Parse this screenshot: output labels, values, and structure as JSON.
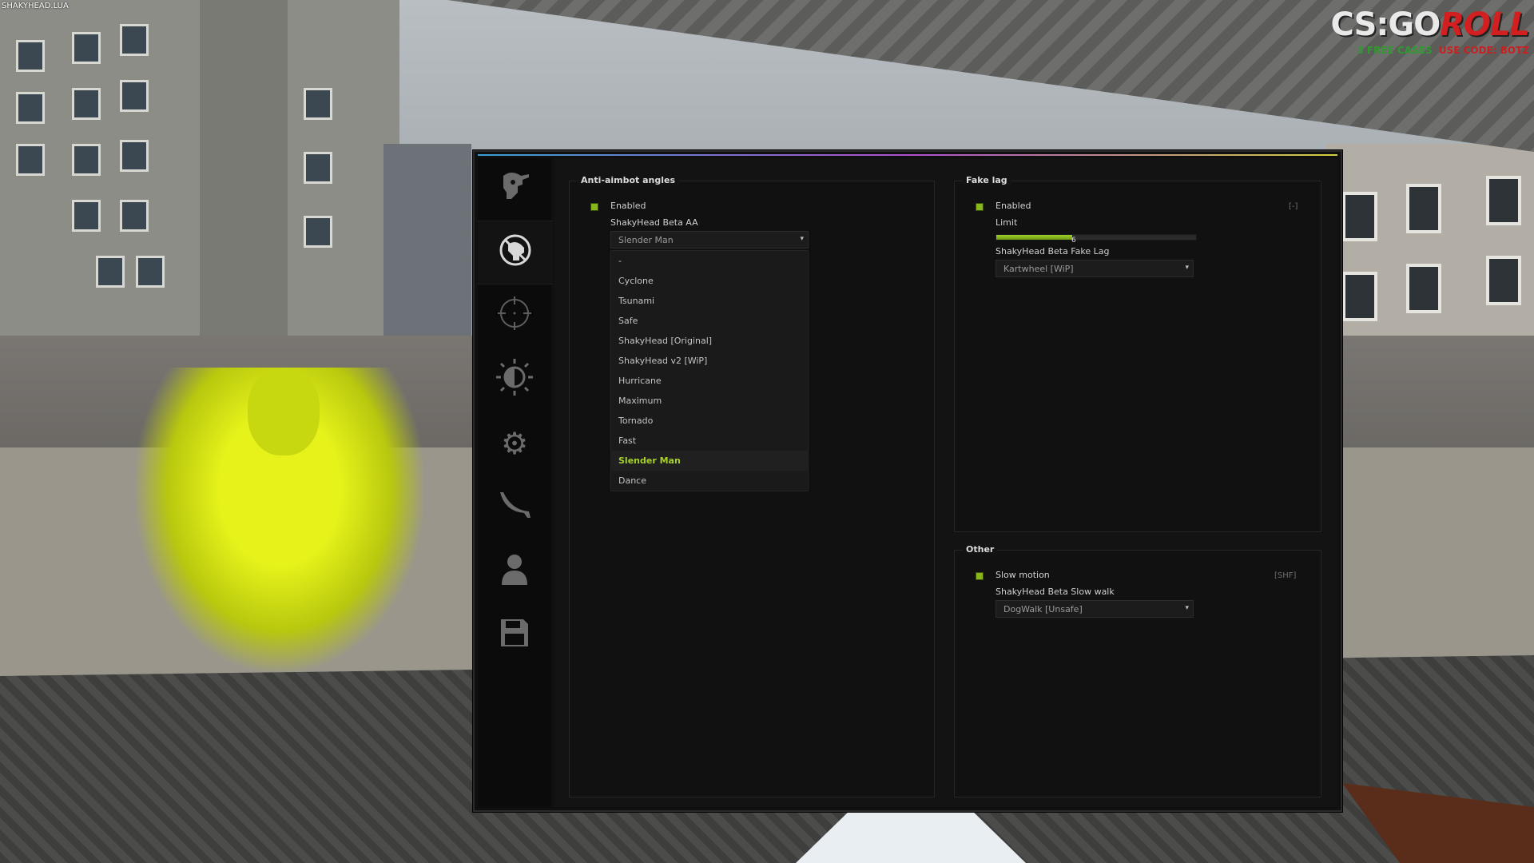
{
  "hud": {
    "script_label": "SHAKYHEAD.LUA",
    "brand_logo": "CS:GO",
    "brand_logo_accent": "ROLL",
    "brand_sub_green": "3 FREE CASES",
    "brand_sub_red": "USE CODE: BOTZ"
  },
  "colors": {
    "accent": "#86b81a",
    "selected_text": "#a6d22a",
    "gradient_bar": [
      "#3aa0d0",
      "#b04fd0",
      "#d0d040"
    ]
  },
  "sidebar": {
    "tabs": [
      {
        "icon": "masked-head-icon",
        "active": false
      },
      {
        "icon": "anti-aim-icon",
        "active": true
      },
      {
        "icon": "crosshair-icon",
        "active": false
      },
      {
        "icon": "visuals-sun-icon",
        "active": false
      },
      {
        "icon": "gears-icon",
        "active": false
      },
      {
        "icon": "knife-icon",
        "active": false
      },
      {
        "icon": "player-icon",
        "active": false
      },
      {
        "icon": "save-icon",
        "active": false
      }
    ]
  },
  "anti_aim": {
    "title": "Anti-aimbot angles",
    "enabled_label": "Enabled",
    "enabled": true,
    "mode_label": "ShakyHead Beta AA",
    "mode_value": "Slender Man",
    "options": [
      "-",
      "Cyclone",
      "Tsunami",
      "Safe",
      "ShakyHead [Original]",
      "ShakyHead v2 [WiP]",
      "Hurricane",
      "Maximum",
      "Tornado",
      "Fast",
      "Slender Man",
      "Dance"
    ],
    "selected_option": "Slender Man"
  },
  "fake_lag": {
    "title": "Fake lag",
    "enabled_label": "Enabled",
    "enabled": true,
    "keybind": "[-]",
    "limit_label": "Limit",
    "limit_value": "6",
    "limit_fraction": 0.38,
    "mode_label": "ShakyHead Beta Fake Lag",
    "mode_value": "Kartwheel [WiP]"
  },
  "other": {
    "title": "Other",
    "slow_motion_label": "Slow motion",
    "slow_motion_enabled": true,
    "keybind": "[SHF]",
    "slow_walk_label": "ShakyHead Beta Slow walk",
    "slow_walk_value": "DogWalk [Unsafe]"
  }
}
